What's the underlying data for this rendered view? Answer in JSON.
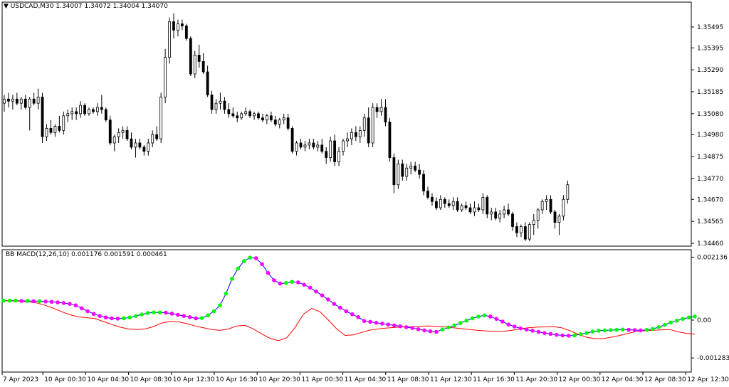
{
  "colors": {
    "background": "#ffffff",
    "candle": "#000000",
    "bull_fill": "#ffffff",
    "bear_fill": "#000000",
    "macd_line": "#0000ff",
    "signal_line": "#ff0000",
    "dot_up": "#00ff00",
    "dot_down": "#ff00ff"
  },
  "price_header": {
    "symbol": "USDCAD,M30",
    "ohlc": "1.34007 1.34072 1.34004 1.34070"
  },
  "macd_header": {
    "name": "BB MACD(12,26,10)",
    "values": "0.001176 0.001591 0.000461"
  },
  "price_axis_labels": [
    "1.35495",
    "1.35395",
    "1.35290",
    "1.35185",
    "1.35080",
    "1.34980",
    "1.34875",
    "1.34770",
    "1.34670",
    "1.34565",
    "1.34460"
  ],
  "macd_axis_labels": [
    "0.002136",
    "0.00",
    "-0.001283"
  ],
  "time_labels": [
    "7 Apr 2023",
    "10 Apr 00:30",
    "10 Apr 04:30",
    "10 Apr 08:30",
    "10 Apr 12:30",
    "10 Apr 16:30",
    "10 Apr 20:30",
    "11 Apr 00:30",
    "11 Apr 04:30",
    "11 Apr 08:30",
    "11 Apr 12:30",
    "11 Apr 16:30",
    "11 Apr 20:30",
    "12 Apr 00:30",
    "12 Apr 04:30",
    "12 Apr 08:30",
    "12 Apr 12:30"
  ],
  "chart_data": [
    {
      "type": "candlestick",
      "title": "USDCAD,M30",
      "ylim": [
        1.3446,
        1.3559
      ],
      "candles": [
        [
          1.3513,
          1.3517,
          1.3509,
          1.3515
        ],
        [
          1.3515,
          1.3518,
          1.3511,
          1.3514
        ],
        [
          1.3514,
          1.3517,
          1.351,
          1.3515
        ],
        [
          1.3515,
          1.3518,
          1.3512,
          1.3513
        ],
        [
          1.3513,
          1.3516,
          1.351,
          1.3515
        ],
        [
          1.3515,
          1.3517,
          1.351,
          1.3511
        ],
        [
          1.3511,
          1.3516,
          1.35,
          1.3515
        ],
        [
          1.3515,
          1.3518,
          1.3512,
          1.3513
        ],
        [
          1.3513,
          1.352,
          1.351,
          1.3516
        ],
        [
          1.3516,
          1.3518,
          1.3494,
          1.3497
        ],
        [
          1.3497,
          1.3503,
          1.3495,
          1.3501
        ],
        [
          1.3501,
          1.3505,
          1.3498,
          1.3499
        ],
        [
          1.3499,
          1.3503,
          1.3497,
          1.3502
        ],
        [
          1.3502,
          1.3507,
          1.3499,
          1.35
        ],
        [
          1.35,
          1.3509,
          1.3498,
          1.3507
        ],
        [
          1.3507,
          1.351,
          1.3504,
          1.3508
        ],
        [
          1.3508,
          1.3511,
          1.3505,
          1.3509
        ],
        [
          1.3509,
          1.3511,
          1.3505,
          1.3508
        ],
        [
          1.3508,
          1.3514,
          1.3506,
          1.3512
        ],
        [
          1.3512,
          1.3513,
          1.3507,
          1.3508
        ],
        [
          1.3508,
          1.3511,
          1.3507,
          1.351
        ],
        [
          1.351,
          1.3511,
          1.3508,
          1.3509
        ],
        [
          1.3509,
          1.3513,
          1.3507,
          1.3511
        ],
        [
          1.3511,
          1.3517,
          1.3508,
          1.351
        ],
        [
          1.351,
          1.3511,
          1.3504,
          1.3505
        ],
        [
          1.3505,
          1.3507,
          1.3493,
          1.3494
        ],
        [
          1.3494,
          1.3498,
          1.349,
          1.3497
        ],
        [
          1.3497,
          1.3501,
          1.3494,
          1.3499
        ],
        [
          1.3499,
          1.3502,
          1.3496,
          1.35
        ],
        [
          1.35,
          1.3502,
          1.3495,
          1.3496
        ],
        [
          1.3496,
          1.3499,
          1.3491,
          1.3492
        ],
        [
          1.3492,
          1.3496,
          1.3487,
          1.3494
        ],
        [
          1.3494,
          1.3496,
          1.3491,
          1.3492
        ],
        [
          1.3492,
          1.3493,
          1.3488,
          1.349
        ],
        [
          1.349,
          1.3496,
          1.3488,
          1.3494
        ],
        [
          1.3494,
          1.35,
          1.3492,
          1.3498
        ],
        [
          1.3498,
          1.3502,
          1.3495,
          1.3496
        ],
        [
          1.3496,
          1.3518,
          1.3494,
          1.3516
        ],
        [
          1.3516,
          1.3539,
          1.3513,
          1.3535
        ],
        [
          1.3535,
          1.3554,
          1.3532,
          1.3552
        ],
        [
          1.3552,
          1.3556,
          1.3544,
          1.3548
        ],
        [
          1.3548,
          1.3553,
          1.3545,
          1.3551
        ],
        [
          1.3551,
          1.3553,
          1.3548,
          1.355
        ],
        [
          1.355,
          1.3551,
          1.3543,
          1.3544
        ],
        [
          1.3544,
          1.3545,
          1.3526,
          1.3527
        ],
        [
          1.3527,
          1.3538,
          1.3525,
          1.3536
        ],
        [
          1.3536,
          1.3541,
          1.353,
          1.3533
        ],
        [
          1.3533,
          1.3537,
          1.3527,
          1.3528
        ],
        [
          1.3528,
          1.3531,
          1.3516,
          1.3517
        ],
        [
          1.3517,
          1.3519,
          1.3508,
          1.351
        ],
        [
          1.351,
          1.3515,
          1.3508,
          1.3513
        ],
        [
          1.3513,
          1.3518,
          1.351,
          1.3514
        ],
        [
          1.3514,
          1.3516,
          1.3508,
          1.351
        ],
        [
          1.351,
          1.3513,
          1.3506,
          1.3508
        ],
        [
          1.3508,
          1.3511,
          1.3506,
          1.3507
        ],
        [
          1.3507,
          1.3509,
          1.3504,
          1.3506
        ],
        [
          1.3506,
          1.3509,
          1.3505,
          1.3508
        ],
        [
          1.3508,
          1.3511,
          1.3507,
          1.3509
        ],
        [
          1.3509,
          1.351,
          1.3506,
          1.3507
        ],
        [
          1.3507,
          1.3509,
          1.3505,
          1.3508
        ],
        [
          1.3508,
          1.3509,
          1.3505,
          1.3506
        ],
        [
          1.3506,
          1.3508,
          1.3504,
          1.3505
        ],
        [
          1.3505,
          1.3508,
          1.3503,
          1.3507
        ],
        [
          1.3507,
          1.3509,
          1.3504,
          1.3505
        ],
        [
          1.3505,
          1.3507,
          1.3502,
          1.3503
        ],
        [
          1.3503,
          1.3506,
          1.3501,
          1.3505
        ],
        [
          1.3505,
          1.3508,
          1.3503,
          1.3506
        ],
        [
          1.3506,
          1.3508,
          1.35,
          1.3501
        ],
        [
          1.3501,
          1.3502,
          1.3489,
          1.349
        ],
        [
          1.349,
          1.3495,
          1.3488,
          1.3494
        ],
        [
          1.3494,
          1.3496,
          1.3491,
          1.3492
        ],
        [
          1.3492,
          1.3495,
          1.349,
          1.3493
        ],
        [
          1.3493,
          1.3496,
          1.3491,
          1.3494
        ],
        [
          1.3494,
          1.3496,
          1.3491,
          1.3492
        ],
        [
          1.3492,
          1.3495,
          1.349,
          1.3493
        ],
        [
          1.3493,
          1.3496,
          1.3489,
          1.349
        ],
        [
          1.349,
          1.3492,
          1.3484,
          1.3487
        ],
        [
          1.3487,
          1.3497,
          1.3485,
          1.3495
        ],
        [
          1.3495,
          1.3498,
          1.3483,
          1.3485
        ],
        [
          1.3485,
          1.3492,
          1.3483,
          1.349
        ],
        [
          1.349,
          1.3496,
          1.3488,
          1.3495
        ],
        [
          1.3495,
          1.3499,
          1.3492,
          1.3496
        ],
        [
          1.3496,
          1.3501,
          1.3493,
          1.3499
        ],
        [
          1.3499,
          1.3502,
          1.3495,
          1.3497
        ],
        [
          1.3497,
          1.3502,
          1.3494,
          1.35
        ],
        [
          1.35,
          1.3508,
          1.3497,
          1.3506
        ],
        [
          1.3506,
          1.3511,
          1.3492,
          1.3494
        ],
        [
          1.3494,
          1.3513,
          1.3492,
          1.3511
        ],
        [
          1.3511,
          1.3513,
          1.3506,
          1.3509
        ],
        [
          1.3509,
          1.3515,
          1.3507,
          1.3511
        ],
        [
          1.3511,
          1.3515,
          1.3502,
          1.3504
        ],
        [
          1.3504,
          1.3506,
          1.3485,
          1.3487
        ],
        [
          1.3487,
          1.3489,
          1.347,
          1.3474
        ],
        [
          1.3474,
          1.3486,
          1.3472,
          1.3484
        ],
        [
          1.3484,
          1.3486,
          1.3476,
          1.3478
        ],
        [
          1.3478,
          1.3484,
          1.3476,
          1.3482
        ],
        [
          1.3482,
          1.3485,
          1.3479,
          1.3483
        ],
        [
          1.3483,
          1.3485,
          1.348,
          1.3481
        ],
        [
          1.3481,
          1.3484,
          1.3477,
          1.3479
        ],
        [
          1.3479,
          1.3481,
          1.3469,
          1.3471
        ],
        [
          1.3471,
          1.3473,
          1.3467,
          1.3468
        ],
        [
          1.3468,
          1.347,
          1.3464,
          1.3466
        ],
        [
          1.3466,
          1.3468,
          1.3462,
          1.3463
        ],
        [
          1.3463,
          1.3469,
          1.3462,
          1.3467
        ],
        [
          1.3467,
          1.3468,
          1.3463,
          1.3465
        ],
        [
          1.3465,
          1.3467,
          1.3463,
          1.3464
        ],
        [
          1.3464,
          1.3468,
          1.3462,
          1.3466
        ],
        [
          1.3466,
          1.3468,
          1.3461,
          1.3462
        ],
        [
          1.3462,
          1.3465,
          1.3461,
          1.3464
        ],
        [
          1.3464,
          1.3466,
          1.3462,
          1.3463
        ],
        [
          1.3463,
          1.3465,
          1.346,
          1.3461
        ],
        [
          1.3461,
          1.3466,
          1.3459,
          1.3463
        ],
        [
          1.3463,
          1.3465,
          1.3461,
          1.3462
        ],
        [
          1.3462,
          1.347,
          1.346,
          1.3468
        ],
        [
          1.3468,
          1.3469,
          1.3458,
          1.346
        ],
        [
          1.346,
          1.3463,
          1.3457,
          1.3461
        ],
        [
          1.3461,
          1.3463,
          1.3457,
          1.3458
        ],
        [
          1.3458,
          1.3462,
          1.3456,
          1.346
        ],
        [
          1.346,
          1.3464,
          1.3458,
          1.3462
        ],
        [
          1.3462,
          1.3465,
          1.3459,
          1.346
        ],
        [
          1.346,
          1.3461,
          1.3452,
          1.3454
        ],
        [
          1.3454,
          1.3456,
          1.3449,
          1.3451
        ],
        [
          1.3451,
          1.3455,
          1.3449,
          1.3454
        ],
        [
          1.3454,
          1.3456,
          1.3447,
          1.3448
        ],
        [
          1.3448,
          1.3456,
          1.3447,
          1.3455
        ],
        [
          1.3455,
          1.346,
          1.345,
          1.3457
        ],
        [
          1.3457,
          1.3463,
          1.3453,
          1.3462
        ],
        [
          1.3462,
          1.3467,
          1.346,
          1.3466
        ],
        [
          1.3466,
          1.3469,
          1.3462,
          1.3467
        ],
        [
          1.3467,
          1.3469,
          1.346,
          1.3461
        ],
        [
          1.3461,
          1.3462,
          1.3453,
          1.3456
        ],
        [
          1.3456,
          1.346,
          1.345,
          1.3459
        ],
        [
          1.3459,
          1.3469,
          1.3457,
          1.3467
        ],
        [
          1.3467,
          1.3476,
          1.3465,
          1.3474
        ]
      ]
    },
    {
      "type": "line",
      "title": "BB MACD(12,26,10)",
      "ylim": [
        -0.00145,
        0.00222
      ],
      "macd": [
        0.00066,
        0.00066,
        0.00066,
        0.00065,
        0.00065,
        0.00064,
        0.00064,
        0.00063,
        0.00062,
        0.0006,
        0.00058,
        0.00055,
        0.0005,
        0.0004,
        0.0003,
        0.00021,
        0.00014,
        9e-05,
        6e-05,
        5e-05,
        6e-05,
        9e-05,
        0.00014,
        0.00019,
        0.00024,
        0.00026,
        0.00026,
        0.00025,
        0.00022,
        0.00018,
        0.00014,
        0.0001,
        6e-05,
        7e-05,
        0.00016,
        0.0003,
        0.0005,
        0.0009,
        0.0014,
        0.00175,
        0.002,
        0.00212,
        0.0021,
        0.0019,
        0.0016,
        0.00135,
        0.00124,
        0.00126,
        0.0013,
        0.00128,
        0.0012,
        0.0011,
        0.00097,
        0.00084,
        0.0007,
        0.00055,
        0.00042,
        0.0003,
        0.0002,
        0.0001,
        -3e-05,
        -6e-05,
        -9e-05,
        -0.00012,
        -0.00015,
        -0.00018,
        -0.00021,
        -0.00024,
        -0.00027,
        -0.00031,
        -0.00035,
        -0.00038,
        -0.0004,
        -0.00032,
        -0.00025,
        -0.00018,
        -0.0001,
        -2e-05,
        6e-05,
        0.00012,
        0.00016,
        0.00012,
        4e-05,
        -5e-05,
        -0.00015,
        -0.00022,
        -0.00028,
        -0.00032,
        -0.00036,
        -0.0004,
        -0.00044,
        -0.00047,
        -0.0005,
        -0.00052,
        -0.00053,
        -0.00052,
        -0.00048,
        -0.00044,
        -0.00039,
        -0.00036,
        -0.00035,
        -0.00034,
        -0.00033,
        -0.00032,
        -0.00033,
        -0.00034,
        -0.00035,
        -0.00033,
        -0.0003,
        -0.00024,
        -0.00016,
        -8e-05,
        -2e-05,
        4e-05,
        9e-05,
        0.00012
      ],
      "signal": [
        0.00066,
        0.00065,
        0.00064,
        0.00062,
        0.00058,
        0.0005,
        0.0004,
        0.00028,
        0.00018,
        0.00011,
        8e-05,
        5e-05,
        -5e-05,
        -0.00015,
        -0.00024,
        -0.0003,
        -0.00032,
        -0.0003,
        -0.00022,
        -0.0001,
        -4e-05,
        -6e-05,
        -0.00012,
        -0.0002,
        -0.00026,
        -0.00032,
        -0.00035,
        -0.0003,
        -0.0002,
        -0.00018,
        -0.0003,
        -0.00047,
        -0.00062,
        -0.0007,
        -0.0006,
        -0.00025,
        0.0002,
        0.0004,
        0.00028,
        0.0,
        -0.0003,
        -0.00052,
        -0.0005,
        -0.00042,
        -0.00034,
        -0.0003,
        -0.00027,
        -0.00025,
        -0.00023,
        -0.00022,
        -0.00021,
        -0.0002,
        -0.00021,
        -0.00023,
        -0.00026,
        -0.00029,
        -0.00032,
        -0.00035,
        -0.00037,
        -0.00038,
        -0.00038,
        -0.00035,
        -0.0003,
        -0.00026,
        -0.00024,
        -0.00023,
        -0.00022,
        -0.00026,
        -0.00036,
        -0.00048,
        -0.00058,
        -0.00063,
        -0.00063,
        -0.00058,
        -0.00052,
        -0.00045,
        -0.00038,
        -0.00036,
        -0.00035,
        -0.00033,
        -0.00032,
        -0.0004,
        -0.00045,
        -0.00048
      ]
    }
  ]
}
